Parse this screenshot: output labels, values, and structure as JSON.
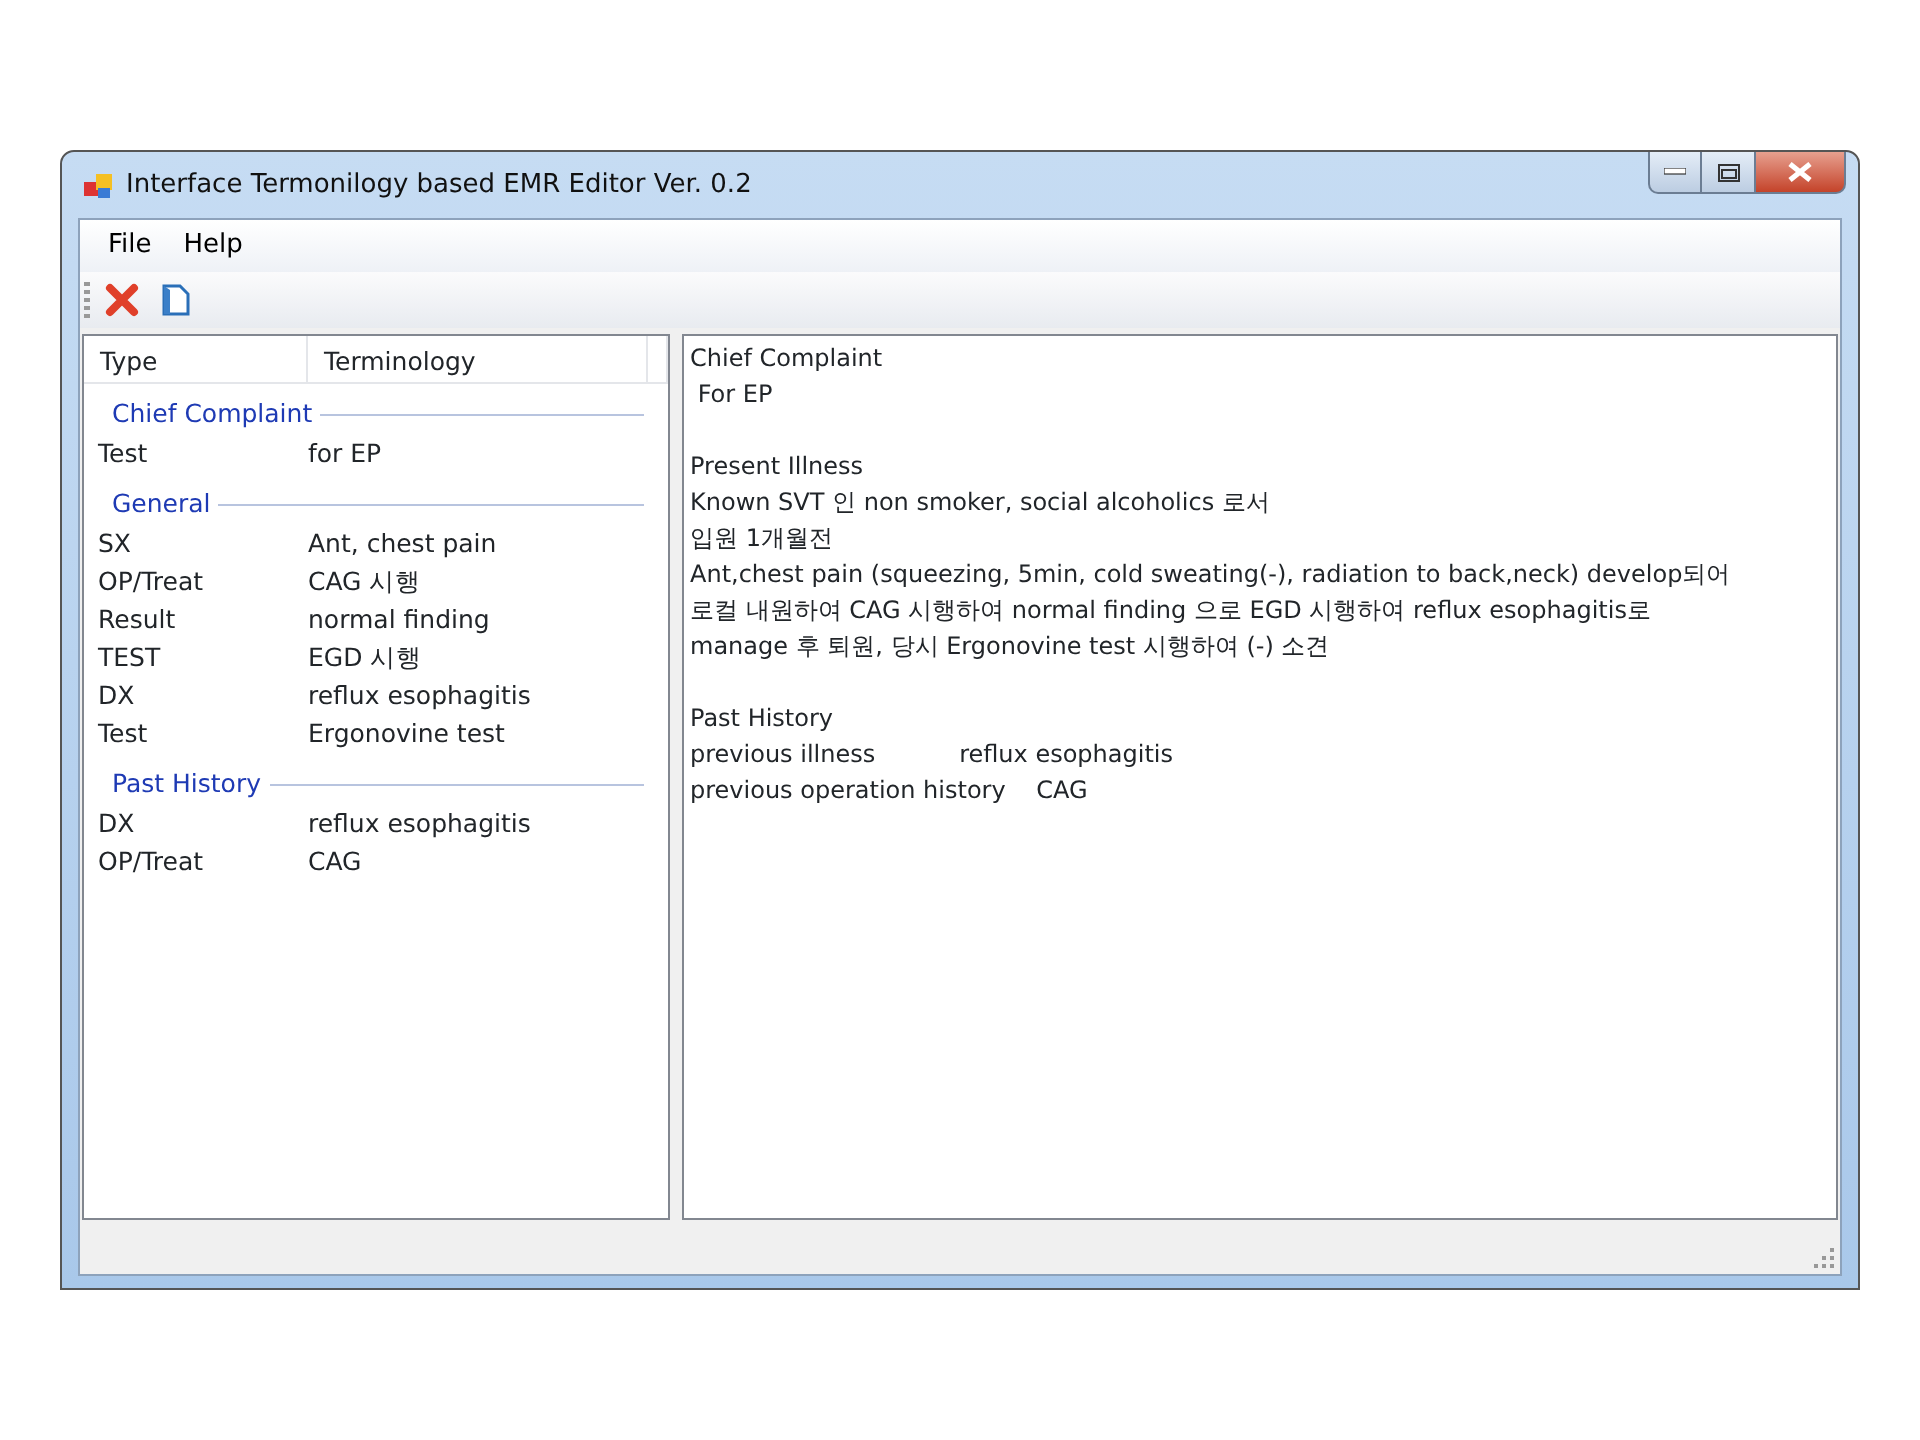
{
  "window": {
    "title": "Interface Termonilogy based EMR Editor Ver. 0.2"
  },
  "menu": [
    "File",
    "Help"
  ],
  "list": {
    "columns": [
      "Type",
      "Terminology"
    ],
    "groups": [
      {
        "label": "Chief Complaint",
        "rows": [
          {
            "type": "Test",
            "term": "for EP"
          }
        ]
      },
      {
        "label": "General",
        "rows": [
          {
            "type": "SX",
            "term": "Ant, chest pain"
          },
          {
            "type": "OP/Treat",
            "term": "CAG 시행"
          },
          {
            "type": "Result",
            "term": "normal finding"
          },
          {
            "type": "TEST",
            "term": "EGD 시행"
          },
          {
            "type": "DX",
            "term": "reflux esophagitis"
          },
          {
            "type": "Test",
            "term": "Ergonovine test"
          }
        ]
      },
      {
        "label": "Past History",
        "rows": [
          {
            "type": "DX",
            "term": "reflux esophagitis"
          },
          {
            "type": "OP/Treat",
            "term": "CAG"
          }
        ]
      }
    ]
  },
  "editor": {
    "blocks": [
      [
        "Chief Complaint",
        " For EP"
      ],
      [
        "Present Illness",
        "Known SVT 인 non smoker, social alcoholics 로서",
        "입원 1개월전",
        "Ant,chest pain (squeezing, 5min, cold sweating(-), radiation to back,neck) develop되어",
        "로컬 내원하여 CAG 시행하여 normal finding 으로 EGD 시행하여 reflux esophagitis로",
        "manage 후 퇴원, 당시 Ergonovine test 시행하여 (-) 소견"
      ],
      [
        "Past History",
        "previous illness           reflux esophagitis",
        "previous operation history    CAG"
      ]
    ]
  }
}
